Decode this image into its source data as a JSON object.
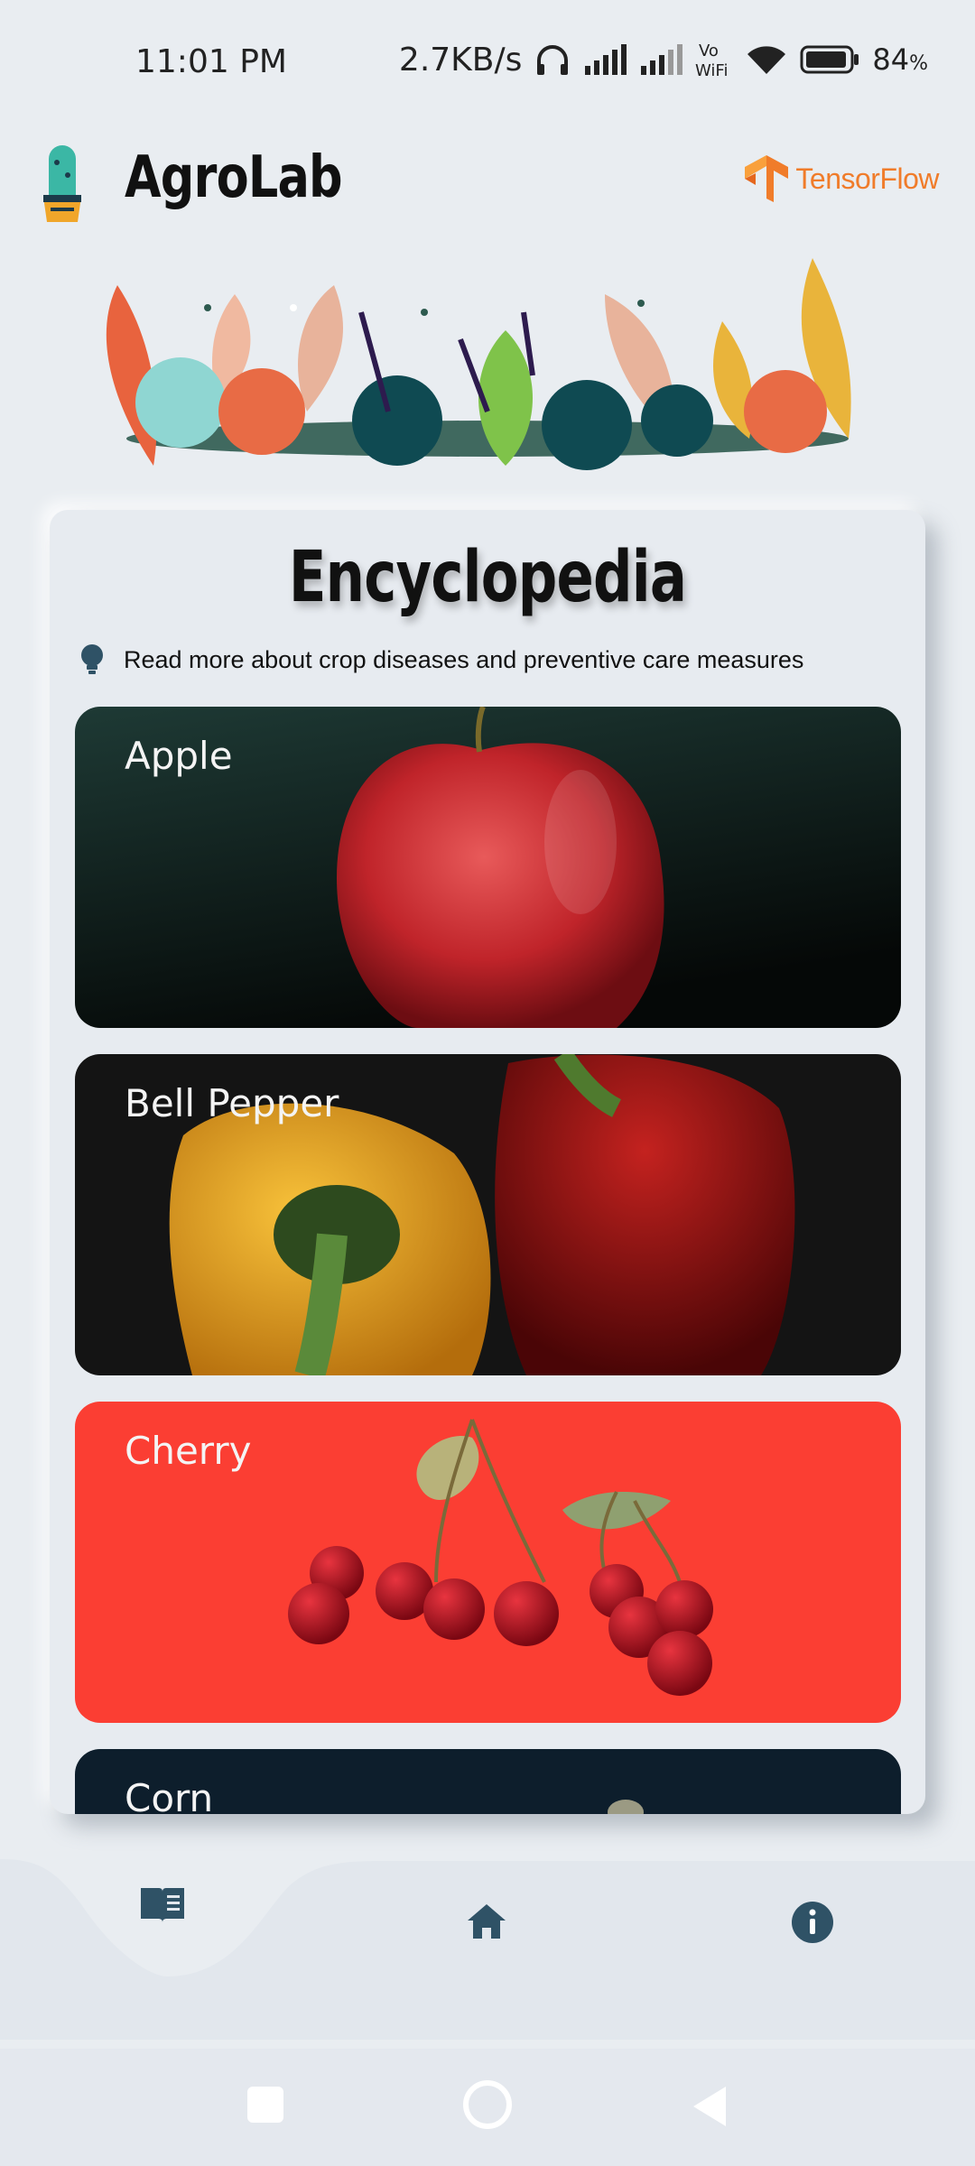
{
  "status_bar": {
    "time": "11:01 PM",
    "speed": "2.7KB/s",
    "battery": "84",
    "battery_unit": "%",
    "icons": [
      "headphones-icon",
      "signal-icon",
      "signal-icon-2",
      "vowifi-icon",
      "wifi-icon",
      "battery-icon"
    ]
  },
  "header": {
    "app_name": "AgroLab",
    "partner": "TensorFlow"
  },
  "encyclopedia": {
    "title": "Encyclopedia",
    "subtitle": "Read more about crop diseases and preventive care measures",
    "crops": [
      {
        "label": "Apple"
      },
      {
        "label": "Bell Pepper"
      },
      {
        "label": "Cherry"
      },
      {
        "label": "Corn"
      }
    ]
  },
  "bottom_nav": {
    "items": [
      {
        "icon": "book-icon",
        "active": true
      },
      {
        "icon": "home-icon",
        "active": false
      },
      {
        "icon": "info-icon",
        "active": false
      }
    ]
  },
  "system_nav": [
    "recents-button",
    "home-button",
    "back-button"
  ],
  "colors": {
    "background": "#e9edf1",
    "accent": "#2f5266",
    "tensorflow": "#f07c2a"
  }
}
